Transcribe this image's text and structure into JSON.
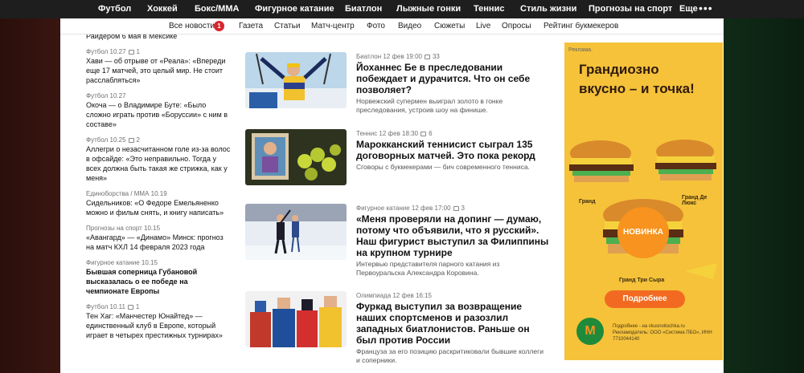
{
  "topnav": {
    "items": [
      "Футбол",
      "Хоккей",
      "Бокс/ММА",
      "Фигурное катание",
      "Биатлон",
      "Лыжные гонки",
      "Теннис",
      "Стиль жизни",
      "Прогнозы на спорт",
      "Еще"
    ],
    "more_icon": "more-dots"
  },
  "subnav": {
    "items": [
      "Все новости",
      "Газета",
      "Статьи",
      "Матч-центр",
      "Фото",
      "Видео",
      "Сюжеты",
      "Live",
      "Опросы",
      "Рейтинг букмекеров"
    ],
    "badge": "1"
  },
  "left_news": [
    {
      "meta": "",
      "comments": "",
      "title": "Раидером 6 мая в Мексике",
      "bold": false
    },
    {
      "meta": "Футбол 10.27",
      "comments": "1",
      "title": "Хави — об отрыве от «Реала»: «Впереди еще 17 матчей, это целый мир. Не стоит расслабляться»",
      "bold": false
    },
    {
      "meta": "Футбол 10.27",
      "comments": "",
      "title": "Окоча — о Владимире Буте: «Было сложно играть против «Боруссии» с ним в составе»",
      "bold": false
    },
    {
      "meta": "Футбол 10.25",
      "comments": "2",
      "title": "Аллегри о незасчитанном голе из-за волос в офсайде: «Это неправильно. Тогда у всех должна быть такая же стрижка, как у меня»",
      "bold": false
    },
    {
      "meta": "Единоборства / ММА 10.19",
      "comments": "",
      "title": "Сидельников: «О Федоре Емельяненко можно и фильм снять, и книгу написать»",
      "bold": false
    },
    {
      "meta": "Прогнозы на спорт 10.15",
      "comments": "",
      "title": "«Авангард» — «Динамо» Минск: прогноз на матч КХЛ 14 февраля 2023 года",
      "bold": false
    },
    {
      "meta": "Фигурное катание 10.15",
      "comments": "",
      "title": "Бывшая соперница Губановой высказалась о ее победе на чемпионате Европы",
      "bold": true
    },
    {
      "meta": "Футбол 10.11",
      "comments": "1",
      "title": "Тен Хаг: «Манчестер Юнайтед» — единственный клуб в Европе, который играет в четырех престижных турнирах»",
      "bold": false
    }
  ],
  "main_news": [
    {
      "meta": "Биатлон 12 фев 19:00",
      "comments": "33",
      "title": "Йоханнес Бе в преследовании побеждает и дурачится. Что он себе позволяет?",
      "lead": "Норвежский супермен выиграл золото в гонке преследования, устроив шоу на финише."
    },
    {
      "meta": "Теннис 12 фев 18:30",
      "comments": "6",
      "title": "Марокканский теннисист сыграл 135 договорных матчей. Это пока рекорд",
      "lead": "Сговоры с букмекерами — бич современного тенниса."
    },
    {
      "meta": "Фигурное катание 12 фев 17:00",
      "comments": "3",
      "title": "«Меня проверяли на допинг — думаю, потому что объявили, что я русский». Наш фигурист выступил за Филиппины на крупном турнире",
      "lead": "Интервью представителя парного катания из Первоуральска Александра Коровина."
    },
    {
      "meta": "Олимпиада 12 фев 16:15",
      "comments": "",
      "title": "Фуркад выступил за возвращение наших спортсменов и разозлил западных биатлонистов. Раньше он был против России",
      "lead": "Француза за его позицию раскритиковали бывшие коллеги и соперники."
    }
  ],
  "ad": {
    "label": "Реклама.",
    "headline": "Грандиозно вкусно – и точка!",
    "badge": "НОВИНКА",
    "captions": [
      "Гранд",
      "Гранд Де Люкс",
      "Гранд Три Сыра"
    ],
    "button": "Подробнее",
    "logo": "М",
    "fine_print": "Подробнее - на vkusnoitochka.ru Рекламодатель: ООО «Система ПБО», ИНН 7710044140"
  },
  "colors": {
    "topnav_bg": "#1e1e1e",
    "badge": "#d7262e",
    "ad_bg": "#f5c23a",
    "ad_button": "#f26a21",
    "logo_bg": "#1e8a3a"
  }
}
